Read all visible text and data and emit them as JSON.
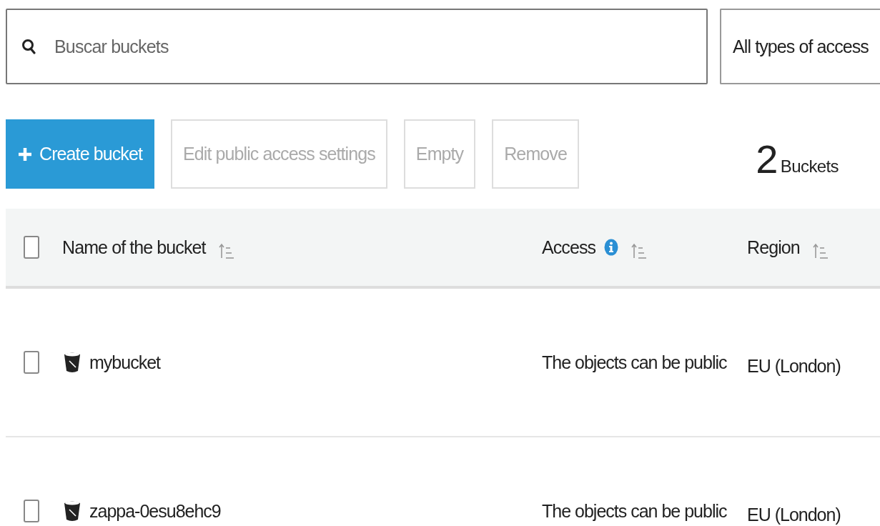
{
  "search": {
    "placeholder": "Buscar buckets"
  },
  "access_filter": {
    "value": "All types of access"
  },
  "buttons": [
    {
      "label": "Create bucket",
      "kind": "primary",
      "disabled": false
    },
    {
      "label": "Edit public access settings",
      "kind": "plain",
      "disabled": true
    },
    {
      "label": "Empty",
      "kind": "plain",
      "disabled": true
    },
    {
      "label": "Remove",
      "kind": "plain",
      "disabled": true
    }
  ],
  "count": {
    "number": "2",
    "label": "Buckets"
  },
  "table": {
    "select_all": {
      "checked": false
    },
    "columns": [
      {
        "label": "Name of the bucket",
        "info": false,
        "sortable": true
      },
      {
        "label": "Access",
        "info": true,
        "sortable": true
      },
      {
        "label": "Region",
        "info": false,
        "sortable": true
      }
    ],
    "rows": [
      {
        "checked": false,
        "name": "mybucket",
        "access": "The objects can be public",
        "region": "EU (London)"
      },
      {
        "checked": false,
        "name": "zappa-0esu8ehc9",
        "access": "The objects can be public",
        "region": "EU (London)"
      }
    ]
  }
}
